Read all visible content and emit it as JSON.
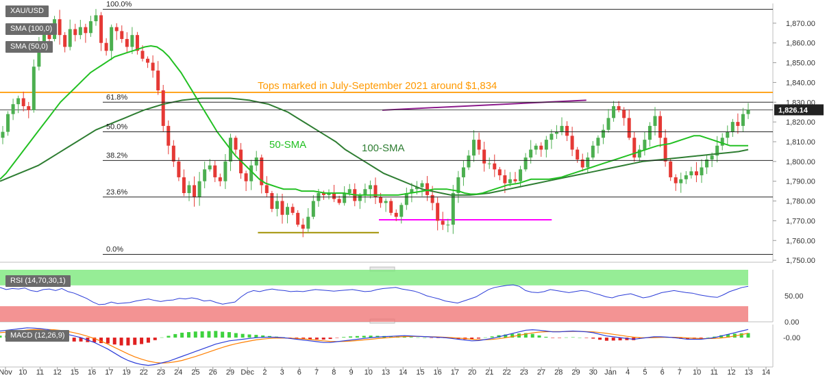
{
  "labels": {
    "symbol": "XAU/USD",
    "sma100": "SMA (100,0)",
    "sma50": "SMA (50,0)",
    "rsi": "RSI (14,70,30,1)",
    "macd": "MACD (12,26,9)"
  },
  "annotations": {
    "tops": "Tops marked in July-September 2021 around $1,834",
    "sma50": "50-SMA",
    "sma100": "100-SMA"
  },
  "price_tag": "1,826.14",
  "colors": {
    "up_candle": "#4caf50",
    "down_candle": "#e53935",
    "sma50": "#22c022",
    "sma100": "#2e7d32",
    "tops_line": "#ff9900",
    "trend_line": "#8b1a8b",
    "support_magenta": "#ff00ff",
    "support_olive": "#a09000",
    "rsi_line": "#2a3bd8",
    "rsi_overbought_zone": "#7ce87c",
    "rsi_oversold_zone": "#f07878",
    "macd_line": "#2a3bd8",
    "signal_line": "#ff7f00"
  },
  "chart_data": [
    {
      "type": "candlestick",
      "title": "XAU/USD",
      "x_ticks": [
        "Nov",
        "10",
        "11",
        "12",
        "15",
        "16",
        "17",
        "19",
        "22",
        "23",
        "24",
        "25",
        "26",
        "29",
        "Dec",
        "2",
        "3",
        "6",
        "7",
        "8",
        "9",
        "10",
        "13",
        "14",
        "15",
        "16",
        "17",
        "20",
        "21",
        "22",
        "23",
        "27",
        "28",
        "29",
        "30",
        "Jan",
        "4",
        "5",
        "6",
        "7",
        "10",
        "11",
        "12",
        "13",
        "14"
      ],
      "y_ticks": [
        "1,750.00",
        "1,760.00",
        "1,770.00",
        "1,780.00",
        "1,790.00",
        "1,800.00",
        "1,810.00",
        "1,820.00",
        "1,830.00",
        "1,840.00",
        "1,850.00",
        "1,860.00",
        "1,870.00"
      ],
      "ylim": [
        1749,
        1880
      ],
      "last_price": 1826.14,
      "fibonacci": [
        {
          "label": "100.0%",
          "value": 1877
        },
        {
          "label": "61.8%",
          "value": 1830
        },
        {
          "label": "50.0%",
          "value": 1815
        },
        {
          "label": "38.2%",
          "value": 1800.5
        },
        {
          "label": "23.6%",
          "value": 1782
        },
        {
          "label": "0.0%",
          "value": 1753
        }
      ],
      "horizontal_levels": [
        {
          "name": "Tops marked in July-September 2021 around $1,834",
          "value": 1835
        }
      ],
      "support_lines": [
        {
          "color": "magenta",
          "value": 1770.5,
          "x_start": "28",
          "x_end": "13"
        },
        {
          "color": "olive",
          "value": 1764,
          "x_start": "2",
          "x_end": "13"
        }
      ],
      "trend_line": {
        "from": {
          "x": "30",
          "y": 1831
        },
        "to": {
          "x": "13",
          "y": 1826
        }
      },
      "close_series": [
        1815,
        1824,
        1829,
        1832,
        1828,
        1826,
        1848,
        1860,
        1866,
        1862,
        1872,
        1864,
        1858,
        1867,
        1864,
        1868,
        1865,
        1871,
        1874,
        1860,
        1856,
        1868,
        1866,
        1862,
        1858,
        1864,
        1856,
        1852,
        1850,
        1846,
        1836,
        1818,
        1808,
        1800,
        1792,
        1784,
        1788,
        1782,
        1790,
        1796,
        1798,
        1792,
        1790,
        1800,
        1812,
        1806,
        1794,
        1790,
        1798,
        1802,
        1788,
        1784,
        1776,
        1780,
        1773,
        1777,
        1774,
        1768,
        1766,
        1772,
        1780,
        1784,
        1783,
        1784,
        1781,
        1779,
        1784,
        1786,
        1780,
        1783,
        1786,
        1788,
        1782,
        1779,
        1780,
        1774,
        1772,
        1778,
        1784,
        1786,
        1787,
        1789,
        1783,
        1779,
        1770,
        1768,
        1768,
        1784,
        1792,
        1797,
        1803,
        1811,
        1806,
        1799,
        1799,
        1796,
        1793,
        1789,
        1791,
        1790,
        1796,
        1802,
        1806,
        1808,
        1806,
        1811,
        1814,
        1815,
        1818,
        1813,
        1806,
        1801,
        1797,
        1802,
        1808,
        1812,
        1816,
        1822,
        1828,
        1826,
        1822,
        1812,
        1802,
        1806,
        1811,
        1818,
        1823,
        1812,
        1800,
        1792,
        1789,
        1791,
        1793,
        1795,
        1793,
        1797,
        1801,
        1803,
        1808,
        1812,
        1815,
        1820,
        1818,
        1824,
        1826.14
      ],
      "sma50_series": [
        1791,
        1794,
        1798,
        1802,
        1806,
        1810,
        1814,
        1818,
        1822,
        1826,
        1830,
        1833,
        1836,
        1839,
        1842,
        1845,
        1847,
        1849,
        1851,
        1853,
        1854,
        1855,
        1856,
        1857,
        1858,
        1858.5,
        1858,
        1856,
        1853,
        1849,
        1845,
        1840,
        1835,
        1830,
        1825,
        1820,
        1815,
        1811,
        1807,
        1803,
        1800,
        1797,
        1794,
        1791,
        1789,
        1788,
        1787,
        1786,
        1786,
        1786,
        1785,
        1785,
        1785,
        1784.5,
        1784,
        1784,
        1784,
        1784,
        1783.5,
        1783,
        1783,
        1783,
        1783,
        1783,
        1783,
        1783,
        1783,
        1783.5,
        1784,
        1784.5,
        1785,
        1785.5,
        1786,
        1786,
        1786,
        1785.5,
        1785,
        1784,
        1783.5,
        1783.5,
        1784,
        1785,
        1786,
        1787,
        1788,
        1788.5,
        1789,
        1790,
        1791,
        1791,
        1791,
        1791,
        1791.5,
        1792,
        1793,
        1794,
        1795,
        1796,
        1797,
        1798,
        1799,
        1800,
        1801,
        1802,
        1803,
        1804,
        1805,
        1806,
        1807,
        1808,
        1808.5,
        1809,
        1810,
        1811,
        1812,
        1813,
        1813,
        1812,
        1811,
        1810,
        1809,
        1808,
        1808,
        1808,
        1808
      ],
      "sma100_series": [
        1790,
        1792,
        1794,
        1796,
        1798,
        1801,
        1804,
        1807,
        1810,
        1813,
        1816,
        1818,
        1820,
        1822,
        1824,
        1826,
        1827.5,
        1829,
        1830,
        1831,
        1831.5,
        1832,
        1832,
        1832,
        1832,
        1831.5,
        1831,
        1830,
        1829,
        1827,
        1825,
        1822,
        1819,
        1816,
        1813,
        1810,
        1806,
        1803,
        1800,
        1797,
        1794,
        1792,
        1790,
        1788,
        1786,
        1785,
        1784,
        1783,
        1783,
        1783,
        1783.5,
        1784,
        1785,
        1786,
        1787,
        1788,
        1789,
        1790,
        1791,
        1792,
        1793,
        1794,
        1795,
        1796,
        1797,
        1798,
        1799,
        1800,
        1800.5,
        1801,
        1801.5,
        1802,
        1802.5,
        1803,
        1803.5,
        1804,
        1804.5,
        1805,
        1806
      ],
      "annotations": [
        "50-SMA",
        "100-SMA"
      ]
    },
    {
      "type": "line",
      "title": "RSI (14,70,30,1)",
      "y_ticks": [
        "0.00",
        "50.00"
      ],
      "ylim": [
        0,
        100
      ],
      "overbought": 70,
      "oversold": 30,
      "values": [
        66,
        62,
        64,
        63,
        65,
        60,
        58,
        62,
        63,
        60,
        64,
        58,
        55,
        50,
        45,
        38,
        33,
        34,
        38,
        35,
        36,
        37,
        40,
        42,
        44,
        41,
        39,
        41,
        42,
        45,
        44,
        46,
        44,
        40,
        41,
        37,
        34,
        36,
        38,
        48,
        56,
        60,
        58,
        61,
        63,
        61,
        60,
        58,
        59,
        58,
        60,
        62,
        61,
        60,
        59,
        60,
        61,
        62,
        60,
        58,
        59,
        62,
        64,
        65,
        66,
        63,
        61,
        59,
        55,
        50,
        47,
        44,
        40,
        38,
        36,
        40,
        44,
        48,
        55,
        62,
        66,
        68,
        70,
        71,
        68,
        60,
        57,
        56,
        58,
        62,
        60,
        58,
        56,
        58,
        60,
        59,
        55,
        52,
        48,
        46,
        50,
        52,
        54,
        50,
        46,
        48,
        52,
        56,
        58,
        60,
        58,
        56,
        55,
        52,
        50,
        48,
        47,
        52,
        58,
        62,
        66,
        68
      ]
    },
    {
      "type": "line",
      "title": "MACD (12,26,9)",
      "y_ticks": [
        "-0.00"
      ],
      "ylim": [
        -18,
        8
      ],
      "macd": [
        4,
        4.5,
        5,
        5.5,
        6,
        5.8,
        5.5,
        5,
        4,
        3,
        2,
        1,
        0,
        -1.5,
        -3,
        -5,
        -7,
        -9.5,
        -12,
        -14,
        -15.5,
        -16.5,
        -17,
        -16.5,
        -15.5,
        -14.5,
        -13,
        -11.5,
        -10,
        -8.5,
        -7,
        -5.5,
        -4,
        -3,
        -2,
        -1.5,
        -1,
        -0.5,
        0,
        0.2,
        0.3,
        0.2,
        0,
        -0.5,
        -1,
        -1.5,
        -2,
        -2.5,
        -3,
        -3,
        -2.5,
        -2,
        -1.5,
        -1,
        -0.5,
        0,
        0.3,
        0.6,
        0.8,
        1,
        1.2,
        1,
        0.8,
        0.6,
        0.4,
        0.2,
        0,
        -0.5,
        -1,
        -1.5,
        -2,
        -1.8,
        -1.2,
        -0.5,
        0.5,
        1.5,
        2.5,
        3.5,
        4.5,
        4.8,
        4.5,
        4,
        3.5,
        3.5,
        3.8,
        4,
        3.8,
        3.5,
        3,
        2,
        1,
        0.5,
        0,
        -0.5,
        -1,
        -0.5,
        0,
        0.5,
        0.5,
        0.3,
        0,
        -0.5,
        -1,
        -1,
        -1,
        -0.5,
        0,
        1,
        2,
        3,
        4,
        5
      ],
      "signal": [
        3,
        3.4,
        3.8,
        4.2,
        4.6,
        4.9,
        5,
        5,
        4.8,
        4.4,
        3.8,
        3,
        2,
        0.8,
        -0.6,
        -2.2,
        -4,
        -6,
        -8,
        -10,
        -11.8,
        -13.2,
        -14.4,
        -15.2,
        -15.6,
        -15.4,
        -14.8,
        -14,
        -12.8,
        -11.6,
        -10.2,
        -8.8,
        -7.4,
        -6,
        -4.8,
        -3.8,
        -2.9,
        -2.1,
        -1.4,
        -0.9,
        -0.5,
        -0.3,
        -0.2,
        -0.3,
        -0.5,
        -0.8,
        -1.2,
        -1.6,
        -2,
        -2.3,
        -2.4,
        -2.3,
        -2.1,
        -1.8,
        -1.4,
        -1,
        -0.6,
        -0.2,
        0.1,
        0.4,
        0.6,
        0.7,
        0.7,
        0.6,
        0.5,
        0.4,
        0.2,
        0,
        -0.3,
        -0.6,
        -1,
        -1.3,
        -1.3,
        -1.1,
        -0.7,
        -0.1,
        0.6,
        1.4,
        2.2,
        2.9,
        3.4,
        3.6,
        3.7,
        3.7,
        3.7,
        3.8,
        3.8,
        3.7,
        3.5,
        3.1,
        2.6,
        2,
        1.4,
        0.8,
        0.3,
        0,
        -0.1,
        0,
        0.1,
        0.2,
        0.2,
        0.1,
        -0.2,
        -0.4,
        -0.6,
        -0.6,
        -0.5,
        -0.2,
        0.3,
        1,
        1.8,
        2.7
      ]
    }
  ]
}
